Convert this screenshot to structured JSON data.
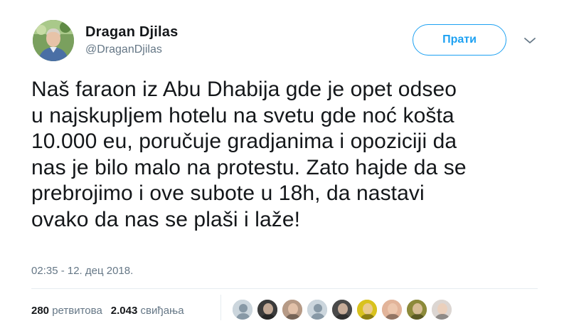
{
  "user": {
    "display_name": "Dragan Djilas",
    "handle": "@DraganDjilas",
    "avatar_icon": "profile-photo"
  },
  "actions": {
    "follow_label": "Прати",
    "menu_icon": "chevron-down-icon"
  },
  "tweet": {
    "lines": [
      "Naš faraon iz Abu Dhabija gde je opet odseo",
      "u najskupljem hotelu na svetu gde noć košta",
      "10.000 eu, poručuje gradjanima i opoziciji da",
      "nas je bilo malo na protestu. Zato hajde da se",
      "prebrojimo i ove subote u 18h, da nastavi",
      "ovako da nas se plaši i laže!"
    ],
    "timestamp": "02:35 - 12. дец 2018."
  },
  "stats": {
    "retweets_count": "280",
    "retweets_label": "ретвитова",
    "likes_count": "2.043",
    "likes_label": "свиђања"
  },
  "likers": [
    {
      "name": "liker-1",
      "icon": "default-avatar-icon",
      "color": "#aab8c2"
    },
    {
      "name": "liker-2",
      "icon": "photo-avatar",
      "color": "#3b3b3b"
    },
    {
      "name": "liker-3",
      "icon": "photo-avatar",
      "color": "#b69a86"
    },
    {
      "name": "liker-4",
      "icon": "default-avatar-icon",
      "color": "#aab8c2"
    },
    {
      "name": "liker-5",
      "icon": "photo-avatar",
      "color": "#4a4a4a"
    },
    {
      "name": "liker-6",
      "icon": "photo-avatar",
      "color": "#d9c21e"
    },
    {
      "name": "liker-7",
      "icon": "photo-avatar",
      "color": "#e2b49a"
    },
    {
      "name": "liker-8",
      "icon": "photo-avatar",
      "color": "#8c8a3a"
    },
    {
      "name": "liker-9",
      "icon": "photo-avatar",
      "color": "#dcd6d2"
    }
  ]
}
